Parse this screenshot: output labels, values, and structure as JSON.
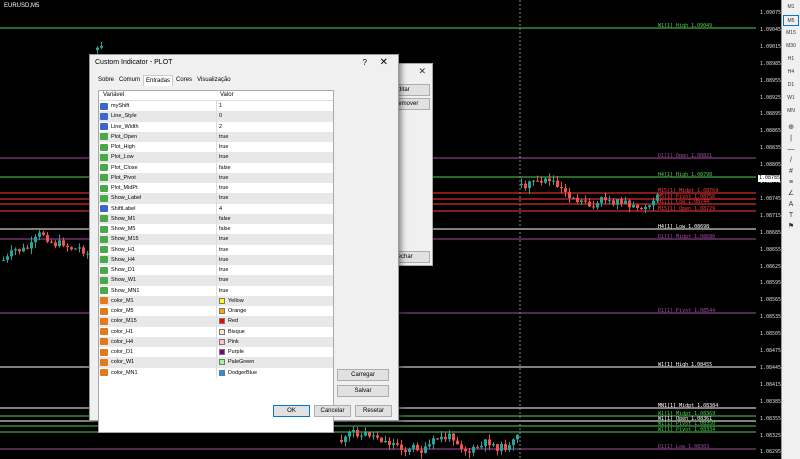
{
  "chart": {
    "symbol": "EURUSD,M5",
    "price_axis": [
      "1.09075",
      "1.09045",
      "1.09015",
      "1.08985",
      "1.08955",
      "1.08925",
      "1.08895",
      "1.08865",
      "1.08835",
      "1.08805",
      "1.08775",
      "1.08745",
      "1.08715",
      "1.08685",
      "1.08655",
      "1.08625",
      "1.08595",
      "1.08565",
      "1.08535",
      "1.08505",
      "1.08475",
      "1.08445",
      "1.08415",
      "1.08385",
      "1.08355",
      "1.08325",
      "1.08295"
    ],
    "current_price": "1.08785",
    "levels": [
      {
        "text": "W1[1] High 1.09049",
        "color": "#4fd14f"
      },
      {
        "text": "D1[1] Open 1.08821",
        "color": "#a64ca6"
      },
      {
        "text": "H4[1] High 1.08798",
        "color": "#4fd14f"
      },
      {
        "text": "M15[1] Midpt 1.08769",
        "color": "#ff3b3b"
      },
      {
        "text": "M5[1] Pivot 1.08756",
        "color": "#ff3b3b"
      },
      {
        "text": "H1[1] Low 1.08744",
        "color": "#ff3b3b"
      },
      {
        "text": "M15[1] Open 1.08729",
        "color": "#ff3b3b"
      },
      {
        "text": "H4[1] Low 1.08698",
        "color": "#ffffff"
      },
      {
        "text": "D1[1] Midpt 1.08680",
        "color": "#a64ca6"
      },
      {
        "text": "D1[1] Pivot 1.08544",
        "color": "#a64ca6"
      },
      {
        "text": "W1[1] High 1.08455",
        "color": "#ffffff"
      },
      {
        "text": "MN1[1] Midpt 1.08384",
        "color": "#ffffff"
      },
      {
        "text": "W1[1] Midpt 1.08369",
        "color": "#4fd14f"
      },
      {
        "text": "W1[1] Open 1.08361",
        "color": "#ffffff"
      },
      {
        "text": "W1[1] Pivot 1.08350",
        "color": "#4fd14f"
      },
      {
        "text": "W1[1] Pivot 1.08334",
        "color": "#4fd14f"
      },
      {
        "text": "D1[1] Low 1.08303",
        "color": "#a64ca6"
      }
    ]
  },
  "timeframes": [
    "M1",
    "M5",
    "M15",
    "M30",
    "H1",
    "H4",
    "D1",
    "W1",
    "MN"
  ],
  "tools": [
    "⊕",
    "|",
    "—",
    "/",
    "#",
    "≡",
    "∠",
    "A",
    "T",
    "⚑"
  ],
  "back_dialog": {
    "btn1": "Editar",
    "btn2": "Remover",
    "btn3": "Fechar"
  },
  "dialog": {
    "title": "Custom Indicator - PLOT",
    "help": "?",
    "close": "✕",
    "tabs": [
      "Sobre",
      "Comum",
      "Entradas",
      "Cores",
      "Visualização"
    ],
    "active_tab": "Entradas",
    "col_var": "Variável",
    "col_val": "Valor",
    "params": [
      {
        "name": "myShift",
        "value": "1",
        "type": "num"
      },
      {
        "name": "Line_Style",
        "value": "0",
        "type": "num"
      },
      {
        "name": "Line_Width",
        "value": "2",
        "type": "num"
      },
      {
        "name": "Plot_Open",
        "value": "true",
        "type": "bool"
      },
      {
        "name": "Plot_High",
        "value": "true",
        "type": "bool"
      },
      {
        "name": "Plot_Low",
        "value": "true",
        "type": "bool"
      },
      {
        "name": "Plot_Close",
        "value": "false",
        "type": "bool"
      },
      {
        "name": "Plot_Pivot",
        "value": "true",
        "type": "bool"
      },
      {
        "name": "Plot_MidPt",
        "value": "true",
        "type": "bool"
      },
      {
        "name": "Show_Label",
        "value": "true",
        "type": "bool"
      },
      {
        "name": "ShiftLabel",
        "value": "4",
        "type": "num"
      },
      {
        "name": "Show_M1",
        "value": "false",
        "type": "bool"
      },
      {
        "name": "Show_M5",
        "value": "false",
        "type": "bool"
      },
      {
        "name": "Show_M15",
        "value": "true",
        "type": "bool"
      },
      {
        "name": "Show_H1",
        "value": "true",
        "type": "bool"
      },
      {
        "name": "Show_H4",
        "value": "true",
        "type": "bool"
      },
      {
        "name": "Show_D1",
        "value": "true",
        "type": "bool"
      },
      {
        "name": "Show_W1",
        "value": "true",
        "type": "bool"
      },
      {
        "name": "Show_MN1",
        "value": "true",
        "type": "bool"
      },
      {
        "name": "color_M1",
        "value": "Yellow",
        "type": "col",
        "swatch": "#ffff00"
      },
      {
        "name": "color_M5",
        "value": "Orange",
        "type": "col",
        "swatch": "#ffa500"
      },
      {
        "name": "color_M15",
        "value": "Red",
        "type": "col",
        "swatch": "#ff0000"
      },
      {
        "name": "color_H1",
        "value": "Bisque",
        "type": "col",
        "swatch": "#ffe4c4"
      },
      {
        "name": "color_H4",
        "value": "Pink",
        "type": "col",
        "swatch": "#ffc0cb"
      },
      {
        "name": "color_D1",
        "value": "Purple",
        "type": "col",
        "swatch": "#800080"
      },
      {
        "name": "color_W1",
        "value": "PaleGreen",
        "type": "col",
        "swatch": "#98fb98"
      },
      {
        "name": "color_MN1",
        "value": "DodgerBlue",
        "type": "col",
        "swatch": "#1e90ff"
      }
    ],
    "load_button": "Carregar",
    "save_button": "Salvar",
    "ok_button": "OK",
    "cancel_button": "Cancelar",
    "reset_button": "Resetar"
  }
}
